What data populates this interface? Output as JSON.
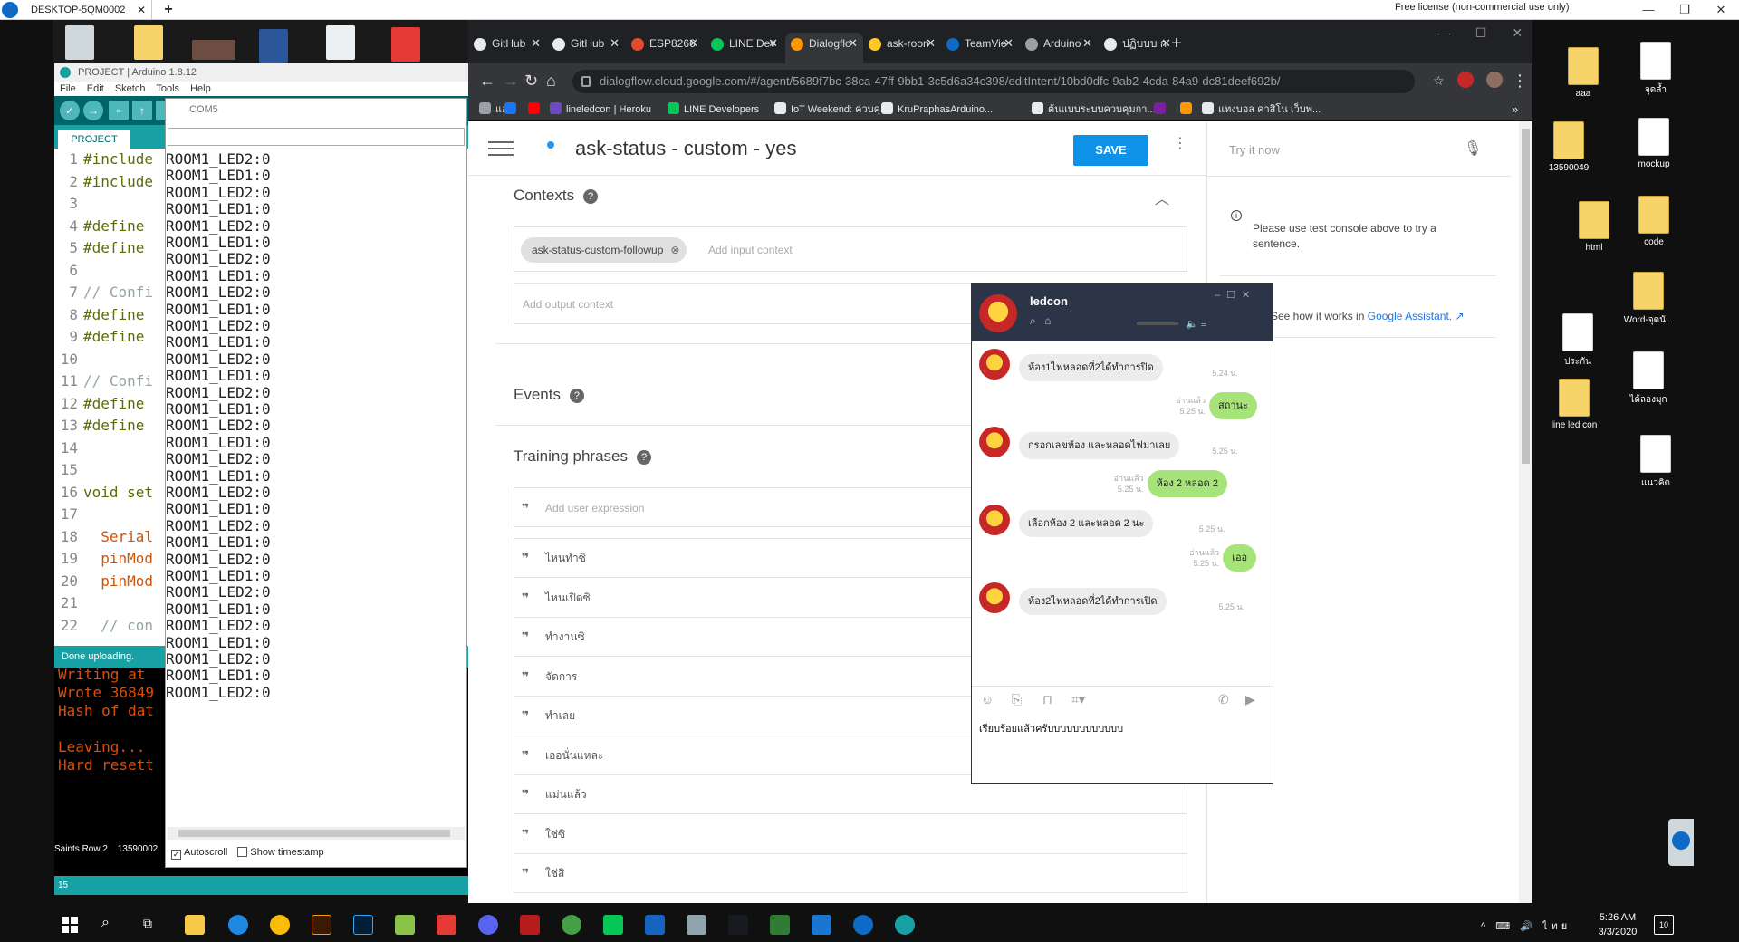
{
  "teamviewer": {
    "tab": "DESKTOP-5QM0002",
    "license": "Free license (non-commercial use only)"
  },
  "arduino": {
    "title": "PROJECT | Arduino 1.8.12",
    "menu": [
      "File",
      "Edit",
      "Sketch",
      "Tools",
      "Help"
    ],
    "tab": "PROJECT",
    "code": [
      {
        "n": "1",
        "t": "#include"
      },
      {
        "n": "2",
        "t": "#include"
      },
      {
        "n": "3",
        "t": ""
      },
      {
        "n": "4",
        "t": "#define"
      },
      {
        "n": "5",
        "t": "#define"
      },
      {
        "n": "6",
        "t": ""
      },
      {
        "n": "7",
        "t": "// Confi"
      },
      {
        "n": "8",
        "t": "#define"
      },
      {
        "n": "9",
        "t": "#define"
      },
      {
        "n": "10",
        "t": ""
      },
      {
        "n": "11",
        "t": "// Confi"
      },
      {
        "n": "12",
        "t": "#define"
      },
      {
        "n": "13",
        "t": "#define"
      },
      {
        "n": "14",
        "t": ""
      },
      {
        "n": "15",
        "t": ""
      },
      {
        "n": "16",
        "t": "void set"
      },
      {
        "n": "17",
        "t": ""
      },
      {
        "n": "18",
        "t": "  Serial"
      },
      {
        "n": "19",
        "t": "  pinMod"
      },
      {
        "n": "20",
        "t": "  pinMod"
      },
      {
        "n": "21",
        "t": ""
      },
      {
        "n": "22",
        "t": "  // con"
      }
    ],
    "status": "Done uploading.",
    "console": [
      "Writing at",
      "Wrote 36849",
      "Hash of dat",
      "",
      "Leaving...",
      "Hard resett"
    ],
    "footer_line": "15",
    "footer_board": "Saints Row 2",
    "footer_num": "13590002"
  },
  "com5": {
    "title": "COM5",
    "log": [
      "ROOM1_LED2:0",
      "ROOM1_LED1:0",
      "ROOM1_LED2:0",
      "ROOM1_LED1:0",
      "ROOM1_LED2:0",
      "ROOM1_LED1:0",
      "ROOM1_LED2:0",
      "ROOM1_LED1:0",
      "ROOM1_LED2:0",
      "ROOM1_LED1:0",
      "ROOM1_LED2:0",
      "ROOM1_LED1:0",
      "ROOM1_LED2:0",
      "ROOM1_LED1:0",
      "ROOM1_LED2:0",
      "ROOM1_LED1:0",
      "ROOM1_LED2:0",
      "ROOM1_LED1:0",
      "ROOM1_LED2:0",
      "ROOM1_LED1:0",
      "ROOM1_LED2:0",
      "ROOM1_LED1:0",
      "ROOM1_LED2:0",
      "ROOM1_LED1:0",
      "ROOM1_LED2:0",
      "ROOM1_LED1:0",
      "ROOM1_LED2:0",
      "ROOM1_LED1:0",
      "ROOM1_LED2:0",
      "ROOM1_LED1:0",
      "ROOM1_LED2:0",
      "ROOM1_LED1:0",
      "ROOM1_LED2:0"
    ],
    "autoscroll": "Autoscroll",
    "timestamp": "Show timestamp"
  },
  "chrome": {
    "tabs": [
      {
        "label": "GitHub",
        "color": "#e8eaed"
      },
      {
        "label": "GitHub",
        "color": "#e8eaed"
      },
      {
        "label": "ESP8266",
        "color": "#e34c26"
      },
      {
        "label": "LINE Dev",
        "color": "#06c755"
      },
      {
        "label": "Dialogflo",
        "color": "#ff9800"
      },
      {
        "label": "ask-roon",
        "color": "#ffca28"
      },
      {
        "label": "TeamVie",
        "color": "#0e6ac7"
      },
      {
        "label": "Arduino",
        "color": "#9aa0a6"
      },
      {
        "label": "ปฏิบบบ ก",
        "color": "#e8eaed"
      }
    ],
    "url": "dialogflow.cloud.google.com/#/agent/5689f7bc-38ca-47ff-9bb1-3c5d6a34c398/editIntent/10bd0dfc-9ab2-4cda-84a9-dc81deef692b/",
    "bookmarks": [
      "แอป",
      "",
      "",
      "lineledcon | Heroku",
      "LINE Developers",
      "IoT Weekend: ควบคุ...",
      "KruPraphasArduino...",
      "ต้นแบบระบบควบคุมกา...",
      "",
      "",
      "แทงบอล คาสิโน เว็บพ..."
    ]
  },
  "dialogflow": {
    "intent_title": "ask-status - custom - yes",
    "save": "SAVE",
    "contexts": "Contexts",
    "input_chip": "ask-status-custom-followup",
    "add_input": "Add input context",
    "add_output": "Add output context",
    "events": "Events",
    "training": "Training phrases",
    "add_expr": "Add user expression",
    "phrases": [
      "ไหนทำซิ",
      "ไหนเปิดซิ",
      "ทำงานซิ",
      "จัดการ",
      "ทำเลย",
      "เออนั่นแหละ",
      "แม่นแล้ว",
      "ใช่ซิ",
      "ใช่สิ"
    ],
    "try_now": "Try it now",
    "note": "Please use test console above to try a sentence.",
    "ga_prefix": "See how it works in",
    "ga_link": "Google Assistant."
  },
  "line_chat": {
    "name": "ledcon",
    "messages": [
      {
        "dir": "in",
        "text": "ห้อง1ไฟหลอดที่2ได้ทำการปิด",
        "time": "5.24 น."
      },
      {
        "dir": "out",
        "text": "สถานะ",
        "read": "อ่านแล้ว",
        "time": "5.25 น."
      },
      {
        "dir": "in",
        "text": "กรอกเลขห้อง และหลอดไฟมาเลย",
        "time": "5.25 น."
      },
      {
        "dir": "out",
        "text": "ห้อง 2 หลอด  2",
        "read": "อ่านแล้ว",
        "time": "5.25 น."
      },
      {
        "dir": "in",
        "text": "เลือกห้อง 2 และหลอด 2 นะ",
        "time": "5.25 น."
      },
      {
        "dir": "out",
        "text": "เออ",
        "read": "อ่านแล้ว",
        "time": "5.25 น."
      },
      {
        "dir": "in",
        "text": "ห้อง2ไฟหลอดที่2ได้ทำการเปิด",
        "time": "5.25 น."
      }
    ],
    "input": "เรียบร้อยแล้วครับบบบบบบบบบบบ"
  },
  "desktop_icons": [
    "aaa",
    "จุดล้ำ",
    "13590049",
    "mockup",
    "html",
    "code",
    "Word-จุดนั...",
    "ประกัน",
    "ได้ลองมุก",
    "line led con",
    "แนวคิด"
  ],
  "taskbar": {
    "time": "5:26 AM",
    "date": "3/3/2020",
    "tray": "ไทย",
    "notif": "10"
  }
}
